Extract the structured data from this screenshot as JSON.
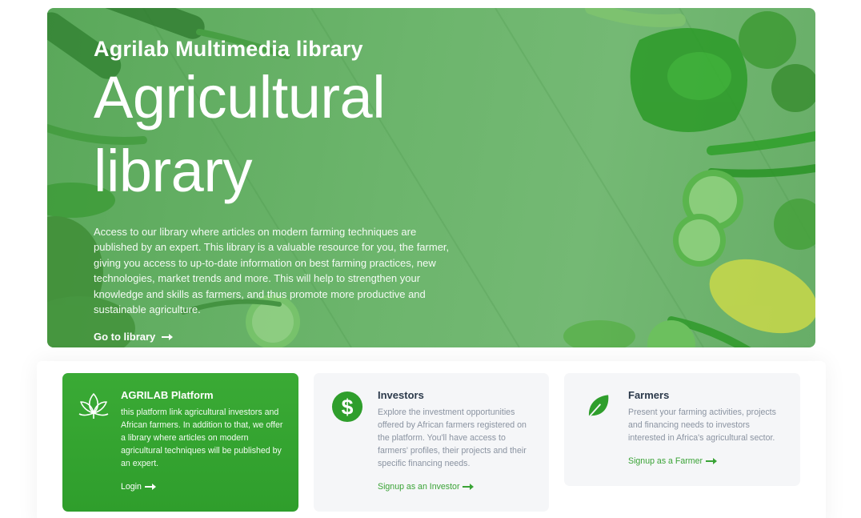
{
  "hero": {
    "kicker": "Agrilab Multimedia library",
    "title_line1": "Agricultural",
    "title_line2": "library",
    "description": "Access to our library where articles on modern farming techniques are published by an expert. This library is a valuable resource for you, the farmer, giving you access to up-to-date information on best farming practices, new technologies, market trends and more. This will help to strengthen your knowledge and skills as farmers, and thus promote more productive and sustainable agriculture.",
    "link_label": "Go to library"
  },
  "cards": {
    "platform": {
      "icon": "plant-sprout-icon",
      "title": "AGRILAB Platform",
      "text": "this platform link agricultural investors and African farmers. In addition to that, we offer a library where articles on modern agricultural techniques will be published by an expert.",
      "link_label": "Login"
    },
    "investors": {
      "icon": "dollar-circle-icon",
      "title": "Investors",
      "text": "Explore the investment opportunities offered by African farmers registered on the platform. You'll have access to farmers' profiles, their projects and their specific financing needs.",
      "link_label": "Signup as an Investor"
    },
    "farmers": {
      "icon": "leaf-icon",
      "title": "Farmers",
      "text": "Present your farming activities, projects and financing needs to investors interested in Africa's agricultural sector.",
      "link_label": "Signup as a Farmer"
    }
  },
  "colors": {
    "brand_green": "#3aaa35",
    "hero_overlay": "#6cb56c",
    "card_bg": "#f5f6f8",
    "title_dark": "#2c3a4b",
    "text_muted": "#8a93a1"
  }
}
